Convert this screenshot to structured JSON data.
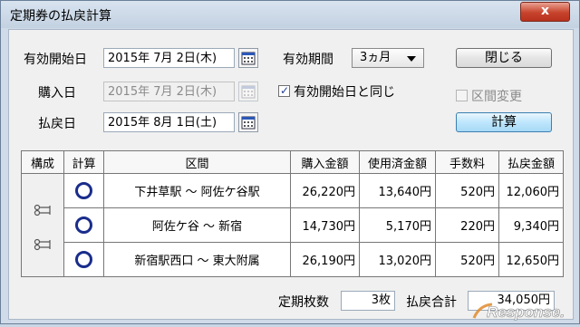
{
  "window": {
    "title": "定期券の払戻計算",
    "close_glyph": "x"
  },
  "form": {
    "valid_start": {
      "label": "有効開始日",
      "value": "2015年 7月 2日(木)"
    },
    "purchase": {
      "label": "購入日",
      "value": "2015年 7月 2日(木)"
    },
    "refund": {
      "label": "払戻日",
      "value": "2015年 8月 1日(土)"
    },
    "period": {
      "label": "有効期間",
      "value": "3ヵ月"
    },
    "same_as_start": {
      "label": "有効開始日と同じ",
      "checked": true
    },
    "change_section": {
      "label": "区間変更",
      "checked": false
    },
    "close_button": "閉じる",
    "calc_button": "計算"
  },
  "table": {
    "headers": [
      "構成",
      "計算",
      "区間",
      "購入金額",
      "使用済金額",
      "手数料",
      "払戻金額"
    ],
    "rows": [
      {
        "section": "下井草駅 ～ 阿佐ケ谷駅",
        "purchase": "26,220円",
        "used": "13,640円",
        "fee": "520円",
        "refund": "12,060円"
      },
      {
        "section": "阿佐ケ谷 ～ 新宿",
        "purchase": "14,730円",
        "used": "5,170円",
        "fee": "220円",
        "refund": "9,340円"
      },
      {
        "section": "新宿駅西口 ～ 東大附属",
        "purchase": "26,190円",
        "used": "13,020円",
        "fee": "520円",
        "refund": "12,650円"
      }
    ]
  },
  "summary": {
    "count_label": "定期枚数",
    "count_value": "3枚",
    "total_label": "払戻合計",
    "total_value": "34,050円"
  },
  "watermark": "Response."
}
